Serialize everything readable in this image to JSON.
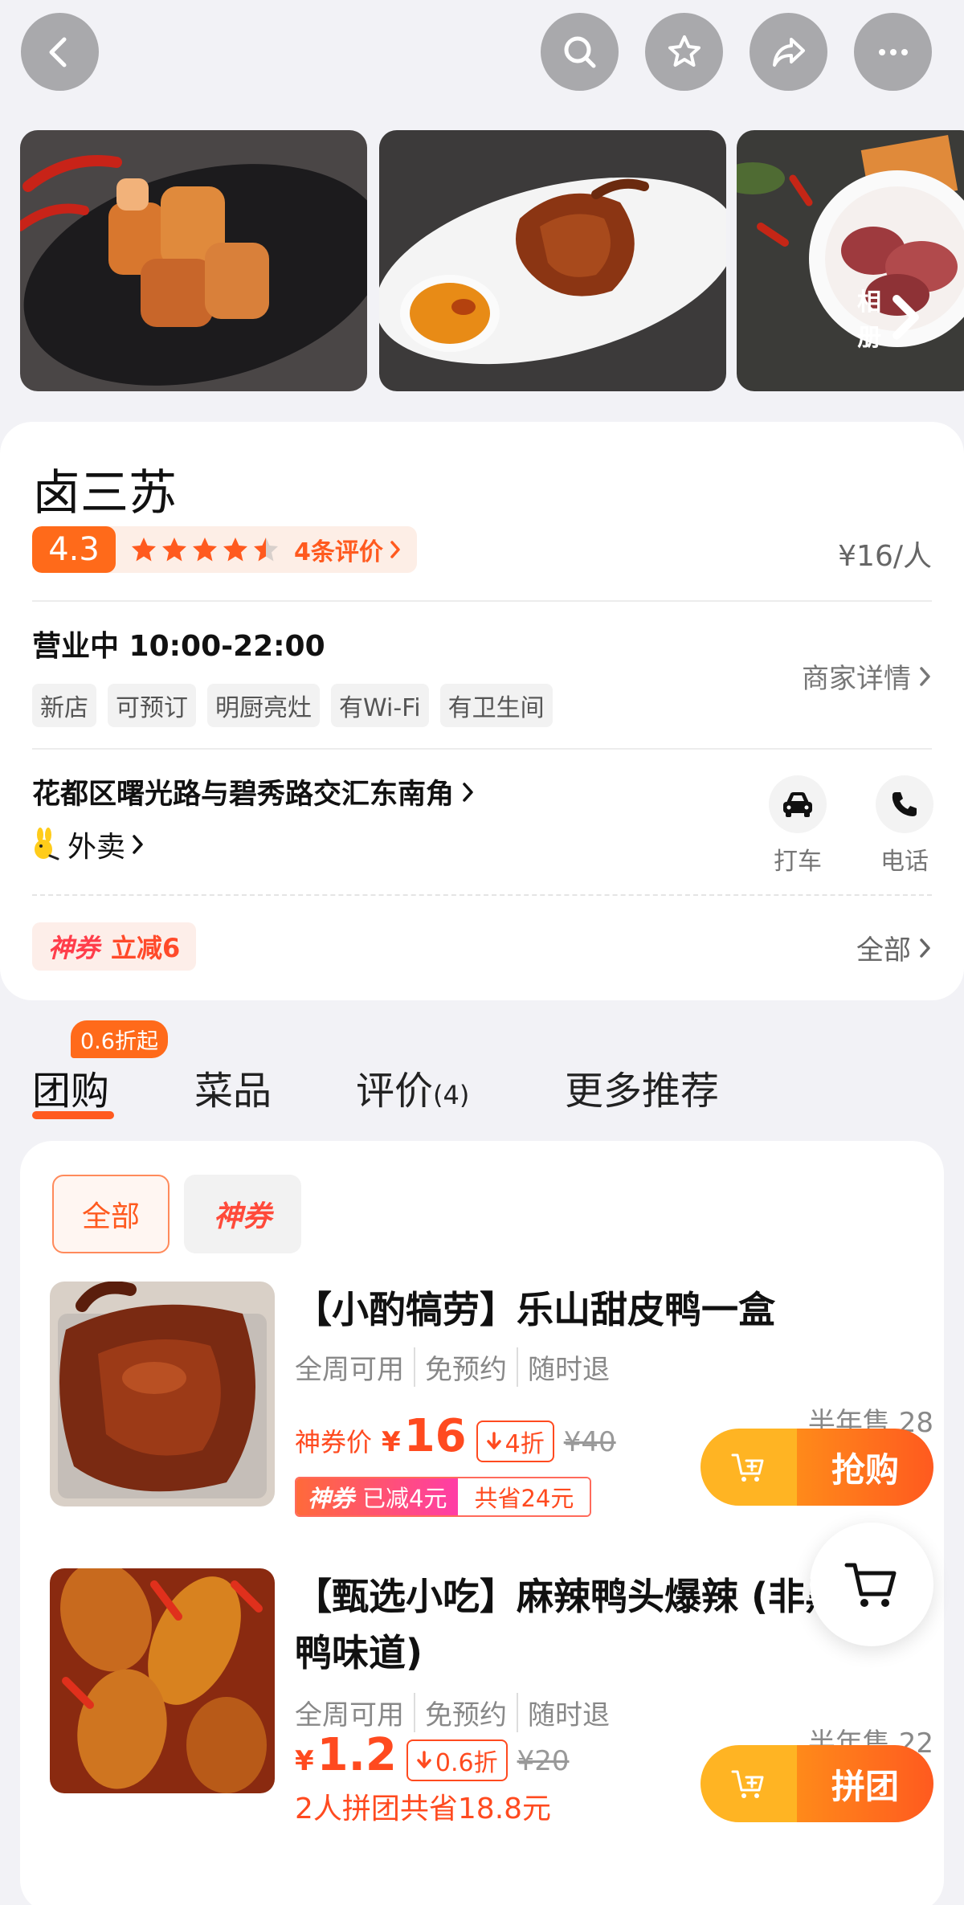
{
  "shop": {
    "name": "卤三苏",
    "rating": "4.3",
    "rating_value": 4.5,
    "review_link": "4条评价",
    "avg_price": "¥16/人",
    "hours": "营业中 10:00-22:00",
    "tags": [
      "新店",
      "可预订",
      "明厨亮灶",
      "有Wi-Fi",
      "有卫生间"
    ],
    "merchant_detail": "商家详情",
    "address": "花都区曙光路与碧秀路交汇东南角",
    "takeout": "外卖",
    "actions": {
      "taxi": "打车",
      "phone": "电话"
    },
    "coupon": {
      "brand": "神券",
      "amount": "立减6"
    },
    "all_link": "全部"
  },
  "gallery": {
    "album_label": "相册"
  },
  "tabs": {
    "badge": "0.6折起",
    "items": [
      {
        "label": "团购"
      },
      {
        "label": "菜品"
      },
      {
        "label": "评价",
        "count": "(4)"
      },
      {
        "label": "更多推荐"
      }
    ]
  },
  "filters": {
    "all": "全部",
    "coupon": "神券"
  },
  "deals": [
    {
      "title": "【小酌犒劳】乐山甜皮鸭一盒",
      "attrs": [
        "全周可用",
        "免预约",
        "随时退"
      ],
      "price_label": "神券价",
      "currency": "¥",
      "price": "16",
      "discount": "4折",
      "original": "¥40",
      "saving_brand": "神券",
      "saving_reduced": "已减4元",
      "saving_total": "共省24元",
      "sold": "半年售 28",
      "button": "抢购"
    },
    {
      "title": "【甄选小吃】麻辣鸭头爆辣 (非黑鸭味道)",
      "attrs": [
        "全周可用",
        "免预约",
        "随时退"
      ],
      "currency": "¥",
      "price": "1.2",
      "discount": "0.6折",
      "original": "¥20",
      "group_save": "2人拼团共省18.8元",
      "sold": "半年售 22",
      "button": "拼团"
    }
  ],
  "colors": {
    "accent": "#ff5a1f",
    "score_bg": "#ff6a1a",
    "cart_yellow": "#ffb423"
  }
}
